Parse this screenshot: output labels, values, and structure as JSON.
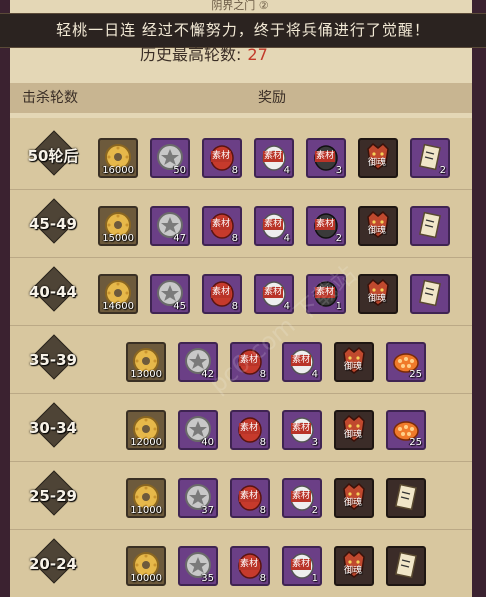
{
  "banner": {
    "text": "轻桃一日连 经过不懈努力，终于将兵俑进行了觉醒！"
  },
  "dialog_title": "阴界之门 ②",
  "history": {
    "label": "历史最高轮数:",
    "value": "27"
  },
  "table": {
    "col_kill": "击杀轮数",
    "col_reward": "奖励"
  },
  "watermark": "pc6.com 下载站",
  "rows": [
    {
      "label": "50轮后",
      "items": [
        {
          "type": "coin",
          "frame": "gold",
          "count": "16000"
        },
        {
          "type": "star-medal",
          "frame": "purple",
          "count": "50"
        },
        {
          "type": "daruma-red",
          "frame": "purple",
          "count": "8",
          "tag": "素材"
        },
        {
          "type": "daruma-white",
          "frame": "purple",
          "count": "4",
          "tag": "素材"
        },
        {
          "type": "daruma-dark",
          "frame": "purple",
          "count": "3",
          "tag": "素材"
        },
        {
          "type": "yuhun",
          "frame": "dark",
          "count": "",
          "text": "御魂"
        },
        {
          "type": "scroll",
          "frame": "purple",
          "count": "2"
        }
      ]
    },
    {
      "label": "45-49",
      "items": [
        {
          "type": "coin",
          "frame": "gold",
          "count": "15000"
        },
        {
          "type": "star-medal",
          "frame": "purple",
          "count": "47"
        },
        {
          "type": "daruma-red",
          "frame": "purple",
          "count": "8",
          "tag": "素材"
        },
        {
          "type": "daruma-white",
          "frame": "purple",
          "count": "4",
          "tag": "素材"
        },
        {
          "type": "daruma-dark",
          "frame": "purple",
          "count": "2",
          "tag": "素材"
        },
        {
          "type": "yuhun",
          "frame": "dark",
          "count": "",
          "text": "御魂"
        },
        {
          "type": "scroll",
          "frame": "purple",
          "count": ""
        }
      ]
    },
    {
      "label": "40-44",
      "items": [
        {
          "type": "coin",
          "frame": "gold",
          "count": "14600"
        },
        {
          "type": "star-medal",
          "frame": "purple",
          "count": "45"
        },
        {
          "type": "daruma-red",
          "frame": "purple",
          "count": "8",
          "tag": "素材"
        },
        {
          "type": "daruma-white",
          "frame": "purple",
          "count": "4",
          "tag": "素材"
        },
        {
          "type": "daruma-dark",
          "frame": "purple",
          "count": "1",
          "tag": "素材"
        },
        {
          "type": "yuhun",
          "frame": "dark",
          "count": "",
          "text": "御魂"
        },
        {
          "type": "scroll",
          "frame": "purple",
          "count": ""
        }
      ]
    },
    {
      "label": "35-39",
      "items": [
        {
          "type": "coin",
          "frame": "gold",
          "count": "13000"
        },
        {
          "type": "star-medal",
          "frame": "purple",
          "count": "42"
        },
        {
          "type": "daruma-red",
          "frame": "purple",
          "count": "8",
          "tag": "素材"
        },
        {
          "type": "daruma-white",
          "frame": "purple",
          "count": "4",
          "tag": "素材"
        },
        {
          "type": "yuhun",
          "frame": "dark",
          "count": "",
          "text": "御魂"
        },
        {
          "type": "sushi",
          "frame": "purple",
          "count": "25"
        }
      ]
    },
    {
      "label": "30-34",
      "items": [
        {
          "type": "coin",
          "frame": "gold",
          "count": "12000"
        },
        {
          "type": "star-medal",
          "frame": "purple",
          "count": "40"
        },
        {
          "type": "daruma-red",
          "frame": "purple",
          "count": "8",
          "tag": "素材"
        },
        {
          "type": "daruma-white",
          "frame": "purple",
          "count": "3",
          "tag": "素材"
        },
        {
          "type": "yuhun",
          "frame": "dark",
          "count": "",
          "text": "御魂"
        },
        {
          "type": "sushi",
          "frame": "purple",
          "count": "25"
        }
      ]
    },
    {
      "label": "25-29",
      "items": [
        {
          "type": "coin",
          "frame": "gold",
          "count": "11000"
        },
        {
          "type": "star-medal",
          "frame": "purple",
          "count": "37"
        },
        {
          "type": "daruma-red",
          "frame": "purple",
          "count": "8",
          "tag": "素材"
        },
        {
          "type": "daruma-white",
          "frame": "purple",
          "count": "2",
          "tag": "素材"
        },
        {
          "type": "yuhun",
          "frame": "dark",
          "count": "",
          "text": "御魂"
        },
        {
          "type": "scroll",
          "frame": "dark",
          "count": ""
        }
      ]
    },
    {
      "label": "20-24",
      "items": [
        {
          "type": "coin",
          "frame": "gold",
          "count": "10000"
        },
        {
          "type": "star-medal",
          "frame": "purple",
          "count": "35"
        },
        {
          "type": "daruma-red",
          "frame": "purple",
          "count": "8",
          "tag": "素材"
        },
        {
          "type": "daruma-white",
          "frame": "purple",
          "count": "1",
          "tag": "素材"
        },
        {
          "type": "yuhun",
          "frame": "dark",
          "count": "",
          "text": "御魂"
        },
        {
          "type": "scroll",
          "frame": "dark",
          "count": ""
        }
      ]
    }
  ]
}
